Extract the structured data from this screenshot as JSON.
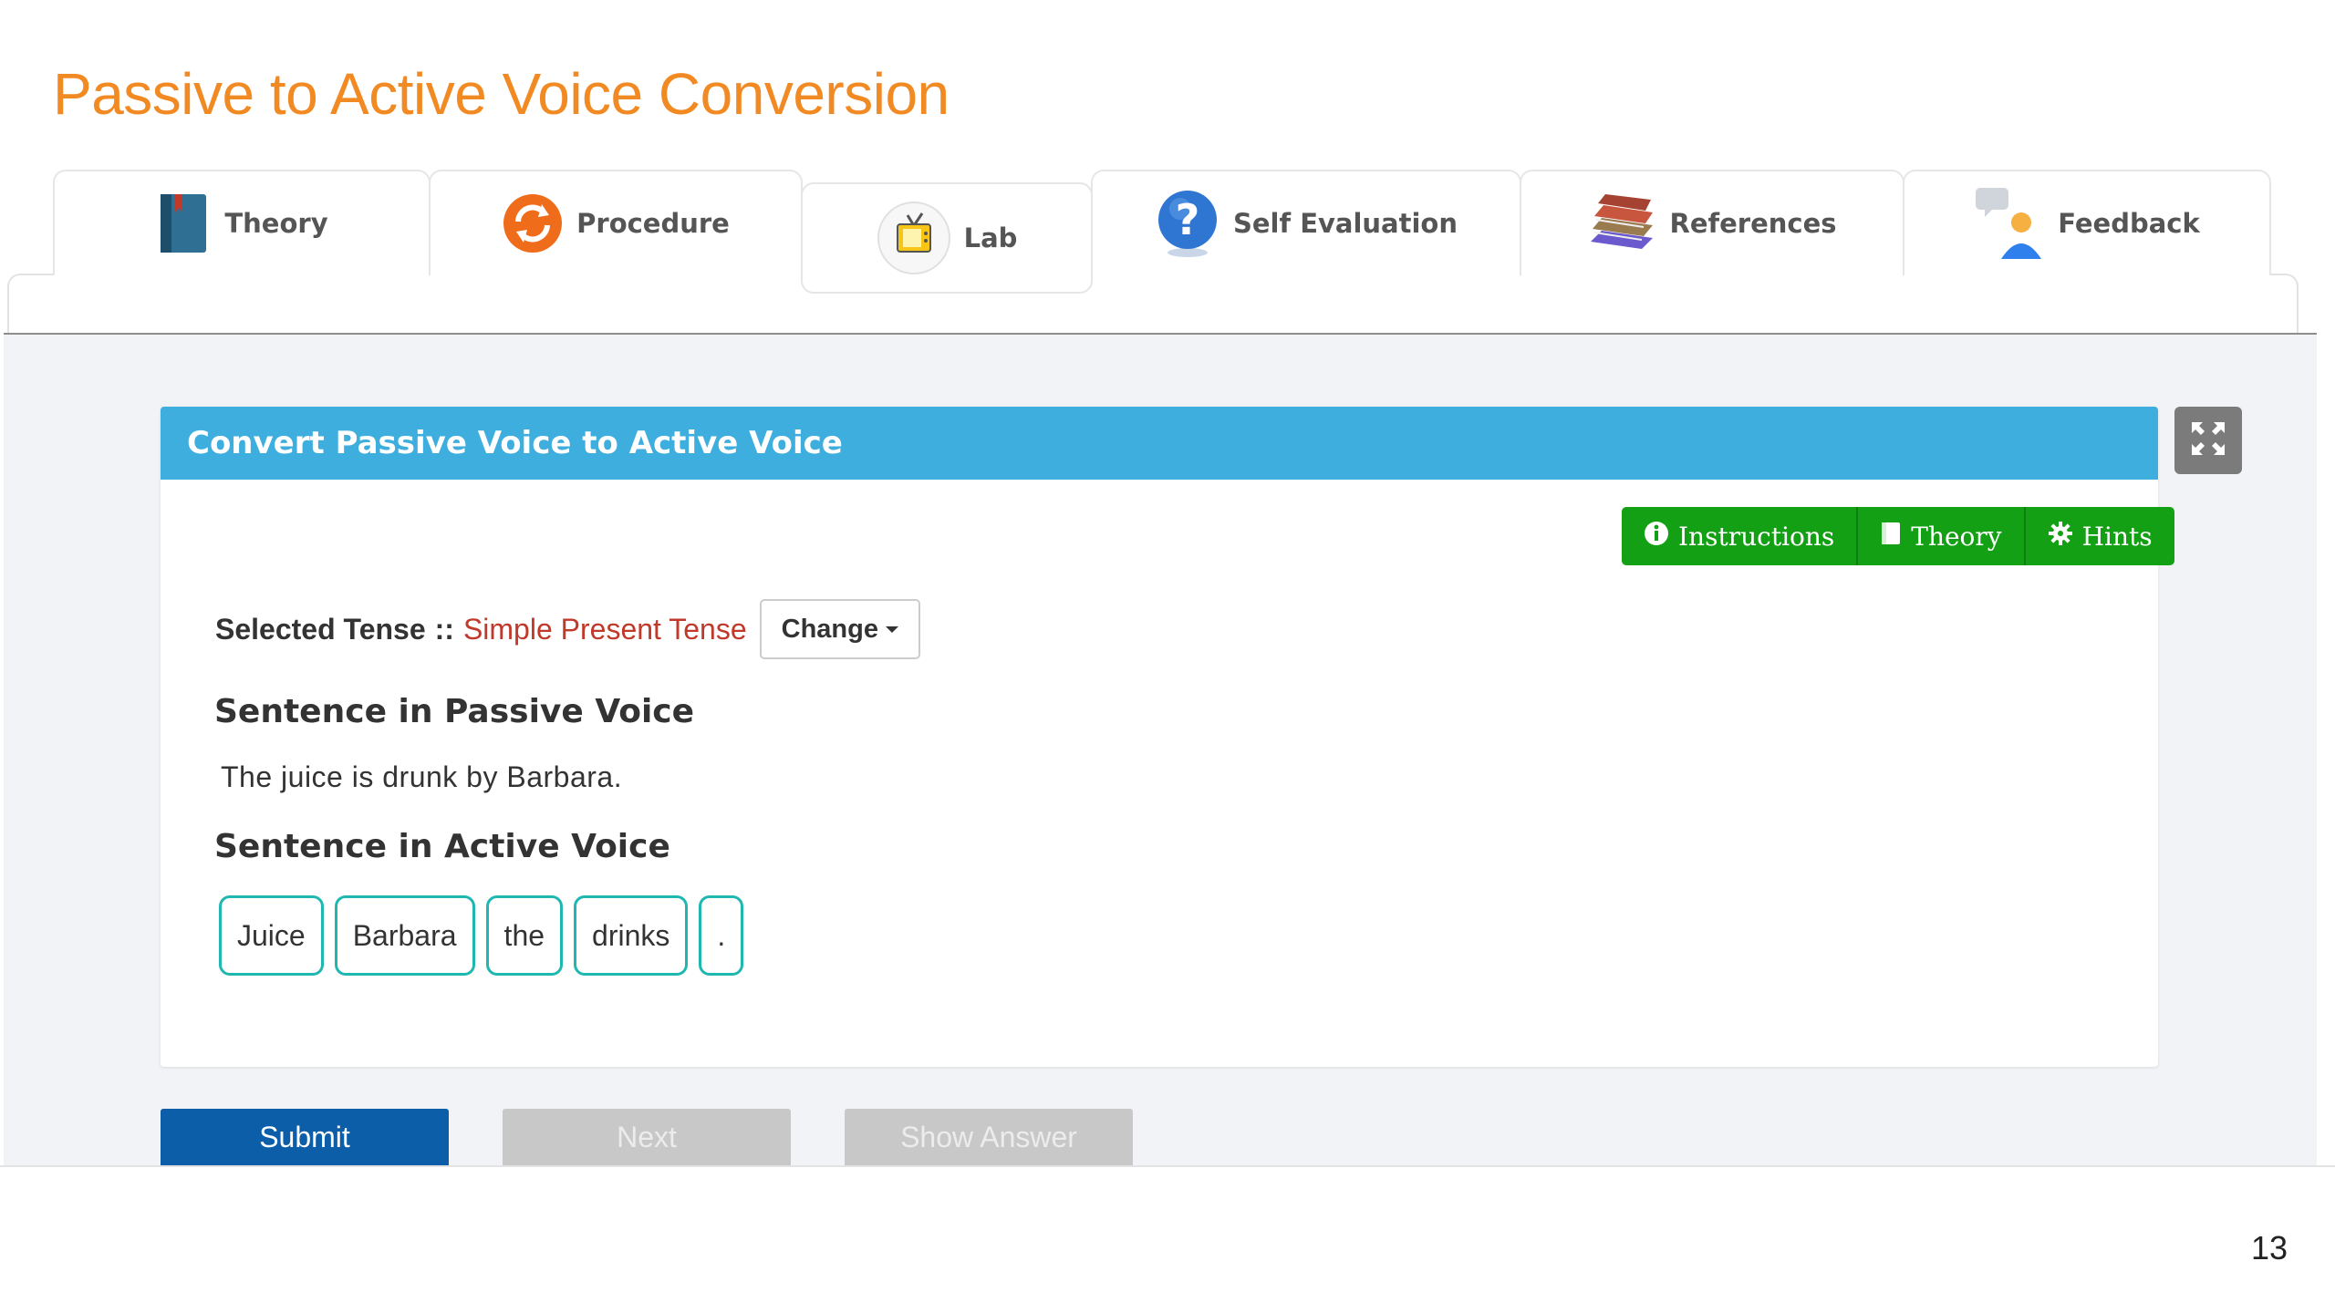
{
  "page": {
    "title": "Passive to Active Voice Conversion",
    "slide_number": "13"
  },
  "tabs": [
    {
      "label": "Theory",
      "icon": "book-icon"
    },
    {
      "label": "Procedure",
      "icon": "refresh-icon"
    },
    {
      "label": "Lab",
      "icon": "tv-icon",
      "active": true
    },
    {
      "label": "Self Evaluation",
      "icon": "question-icon"
    },
    {
      "label": "References",
      "icon": "books-icon"
    },
    {
      "label": "Feedback",
      "icon": "user-chat-icon"
    }
  ],
  "panel": {
    "title": "Convert Passive Voice to Active Voice",
    "helpers": [
      {
        "label": "Instructions",
        "icon": "info-icon"
      },
      {
        "label": "Theory",
        "icon": "book-icon"
      },
      {
        "label": "Hints",
        "icon": "gear-icon"
      }
    ],
    "tense": {
      "label": "Selected Tense",
      "separator": "::",
      "value": "Simple Present Tense",
      "change_label": "Change"
    },
    "passive": {
      "heading": "Sentence in Passive Voice",
      "sentence": "The juice is drunk by Barbara."
    },
    "active": {
      "heading": "Sentence in Active Voice",
      "words": [
        "Juice",
        "Barbara",
        "the",
        "drinks",
        "."
      ]
    }
  },
  "actions": {
    "submit": "Submit",
    "next": "Next",
    "show_answer": "Show Answer"
  },
  "colors": {
    "title": "#f28a24",
    "header": "#3daedd",
    "helper_green": "#14a014",
    "tile_border": "#1fb8b1",
    "submit": "#0d5ea8",
    "tense_value": "#c0392b"
  }
}
